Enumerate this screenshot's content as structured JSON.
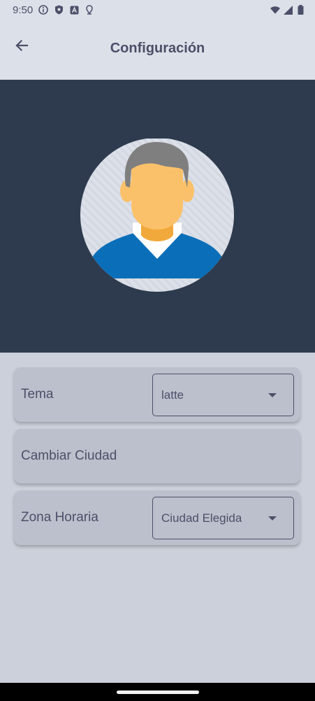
{
  "status_bar": {
    "time": "9:50",
    "icons_left": [
      "info-icon",
      "shield-icon",
      "a-icon",
      "location-icon"
    ],
    "icons_right": [
      "wifi-icon",
      "signal-icon",
      "battery-icon"
    ]
  },
  "app_bar": {
    "title": "Configuración",
    "back_icon": "arrow-back-icon"
  },
  "hero": {
    "background": "#2e3b4e",
    "avatar": "user-avatar"
  },
  "settings": {
    "theme": {
      "label": "Tema",
      "value": "latte"
    },
    "change_city": {
      "label": "Cambiar Ciudad"
    },
    "timezone": {
      "label": "Zona Horaria",
      "value": "Ciudad Elegida"
    }
  },
  "colors": {
    "surface": "#ccd0da",
    "card": "#bcc0cc",
    "bar": "#dce0e8",
    "text": "#4c4f69",
    "accent_blue": "#0a6fb8",
    "skin": "#fbc16a"
  }
}
